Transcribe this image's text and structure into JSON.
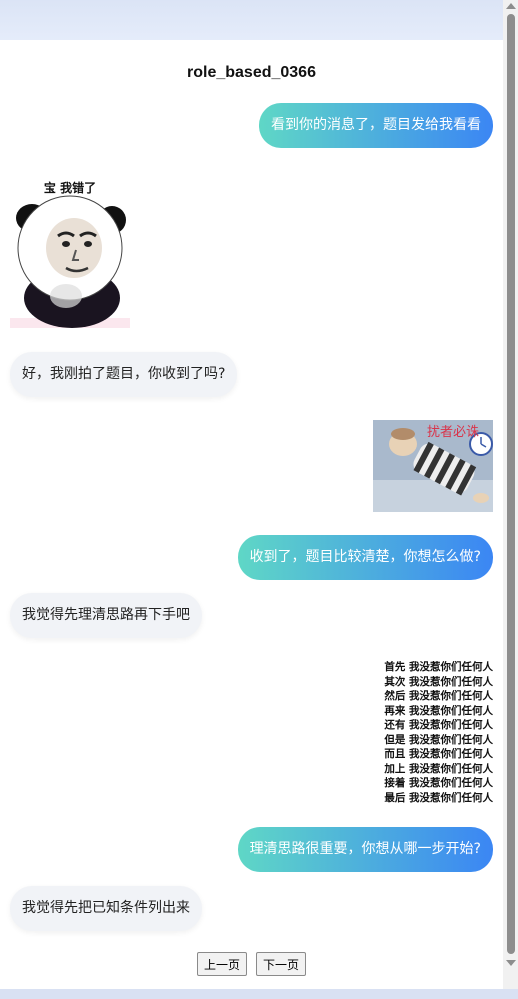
{
  "chat": {
    "title": "role_based_0366",
    "messages": [
      {
        "text": "看到你的消息了，题目发给我看看"
      },
      {
        "text": "好，我刚拍了题目，你收到了吗?"
      },
      {
        "text": "收到了，题目比较清楚，你想怎么做?"
      },
      {
        "text": "我觉得先理清思路再下手吧"
      },
      {
        "text": "理清思路很重要，你想从哪一步开始?"
      },
      {
        "text": "我觉得先把已知条件列出来"
      }
    ],
    "stickers": {
      "panda_caption": "宝 我错了",
      "sleeper_caption": "扰者必诛",
      "list_items": [
        "首先",
        "其次",
        "然后",
        "再来",
        "还有",
        "但是",
        "而且",
        "加上",
        "接着",
        "最后"
      ],
      "list_phrase": "我没惹你们任何人"
    }
  },
  "pager": {
    "prev": "上一页",
    "next": "下一页"
  }
}
